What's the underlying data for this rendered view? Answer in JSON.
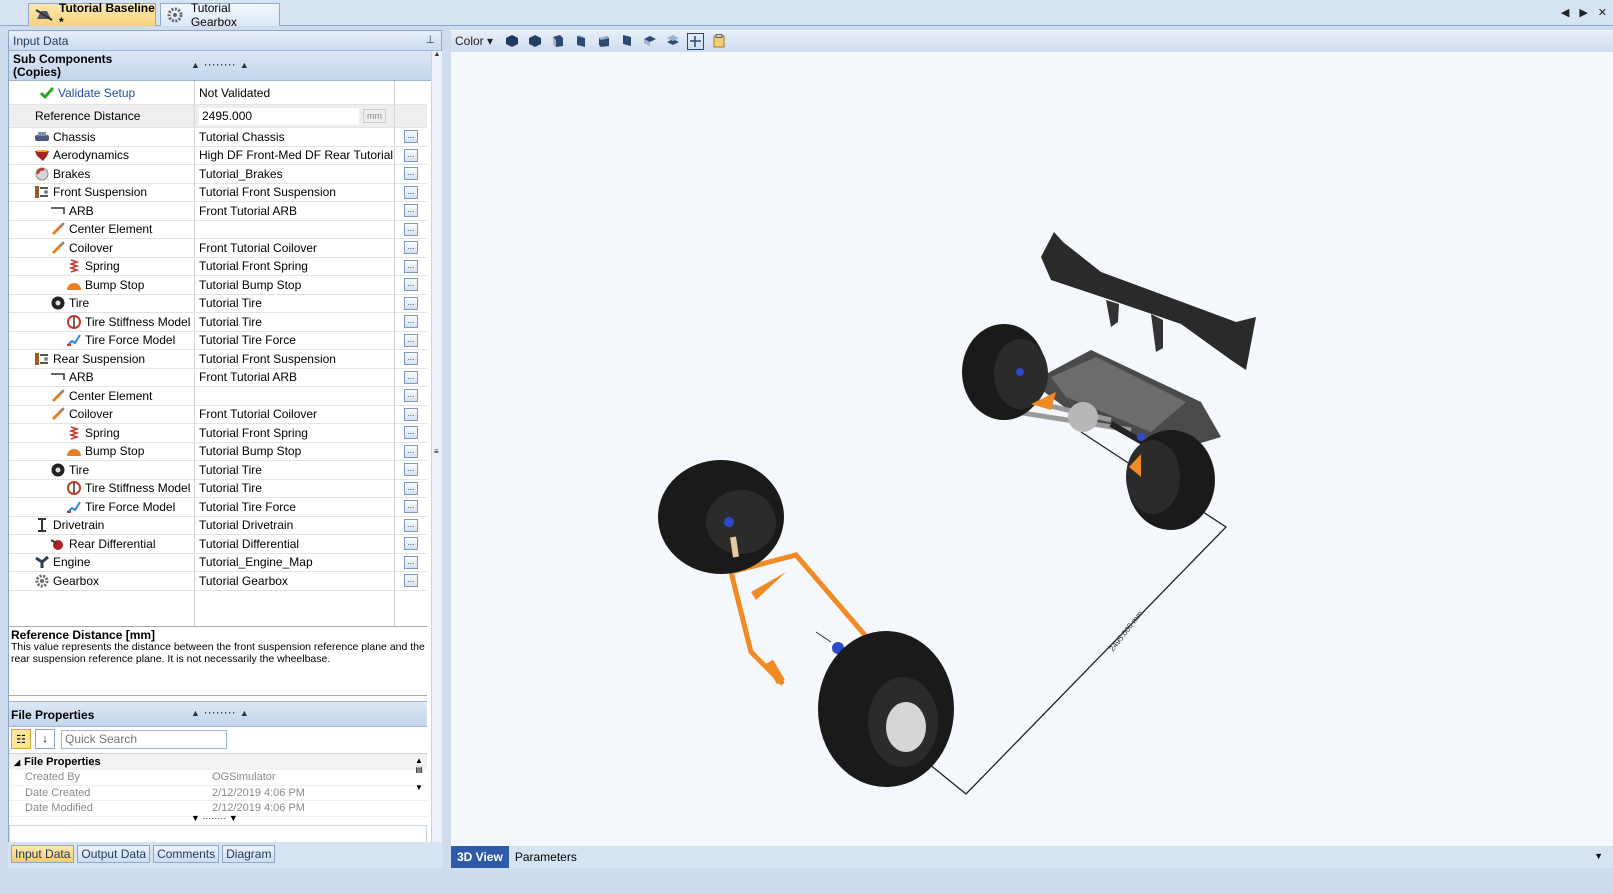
{
  "tabs": [
    {
      "label": "Tutorial Baseline *",
      "icon": "car-icon",
      "active": true
    },
    {
      "label": "Tutorial Gearbox",
      "icon": "gear-icon",
      "active": false
    }
  ],
  "left_panel": {
    "title": "Input Data",
    "subcomponents_header": "Sub Components",
    "subcomponents_subheader": "(Copies)",
    "validate": {
      "label": "Validate Setup",
      "value": "Not Validated"
    },
    "reference_distance": {
      "label": "Reference Distance",
      "value": "2495.000",
      "unit": "mm"
    },
    "rows": [
      {
        "label": "Chassis",
        "value": "Tutorial Chassis",
        "icon": "chassis-icon",
        "level": 0
      },
      {
        "label": "Aerodynamics",
        "value": "High DF Front-Med DF Rear Tutorial",
        "icon": "aerodynamics-icon",
        "level": 0
      },
      {
        "label": "Brakes",
        "value": "Tutorial_Brakes",
        "icon": "brakes-icon",
        "level": 0
      },
      {
        "label": "Front Suspension",
        "value": "Tutorial Front Suspension",
        "icon": "suspension-icon",
        "level": 0
      },
      {
        "label": "ARB",
        "value": "Front Tutorial ARB",
        "icon": "arb-icon",
        "level": 1
      },
      {
        "label": "Center Element",
        "value": "",
        "icon": "damper-icon",
        "level": 1
      },
      {
        "label": "Coilover",
        "value": "Front Tutorial Coilover",
        "icon": "damper-icon",
        "level": 1
      },
      {
        "label": "Spring",
        "value": "Tutorial Front Spring",
        "icon": "spring-icon",
        "level": 2
      },
      {
        "label": "Bump Stop",
        "value": "Tutorial Bump Stop",
        "icon": "bump-stop-icon",
        "level": 2
      },
      {
        "label": "Tire",
        "value": "Tutorial Tire",
        "icon": "tire-icon",
        "level": 1
      },
      {
        "label": "Tire Stiffness Model",
        "value": "Tutorial Tire",
        "icon": "tire-stiffness-icon",
        "level": 2
      },
      {
        "label": "Tire Force Model",
        "value": "Tutorial Tire Force",
        "icon": "tire-force-icon",
        "level": 2
      },
      {
        "label": "Rear Suspension",
        "value": "Tutorial Front Suspension",
        "icon": "suspension-icon",
        "level": 0
      },
      {
        "label": "ARB",
        "value": "Front Tutorial ARB",
        "icon": "arb-icon",
        "level": 1
      },
      {
        "label": "Center Element",
        "value": "",
        "icon": "damper-icon",
        "level": 1
      },
      {
        "label": "Coilover",
        "value": "Front Tutorial Coilover",
        "icon": "damper-icon",
        "level": 1
      },
      {
        "label": "Spring",
        "value": "Tutorial Front Spring",
        "icon": "spring-icon",
        "level": 2
      },
      {
        "label": "Bump Stop",
        "value": "Tutorial Bump Stop",
        "icon": "bump-stop-icon",
        "level": 2
      },
      {
        "label": "Tire",
        "value": "Tutorial Tire",
        "icon": "tire-icon",
        "level": 1
      },
      {
        "label": "Tire Stiffness Model",
        "value": "Tutorial Tire",
        "icon": "tire-stiffness-icon",
        "level": 2
      },
      {
        "label": "Tire Force Model",
        "value": "Tutorial Tire Force",
        "icon": "tire-force-icon",
        "level": 2
      },
      {
        "label": "Drivetrain",
        "value": "Tutorial Drivetrain",
        "icon": "drivetrain-icon",
        "level": 0
      },
      {
        "label": "Rear Differential",
        "value": "Tutorial Differential",
        "icon": "differential-icon",
        "level": 1
      },
      {
        "label": "Engine",
        "value": "Tutorial_Engine_Map",
        "icon": "engine-icon",
        "level": 0
      },
      {
        "label": "Gearbox",
        "value": "Tutorial Gearbox",
        "icon": "gear-icon",
        "level": 0
      }
    ],
    "ellipsis_label": "...",
    "description": {
      "title": "Reference Distance [mm]",
      "text": "This value represents the distance between the front suspension reference plane and the rear suspension reference plane. It is not necessarily the wheelbase."
    },
    "file_properties": {
      "header": "File Properties",
      "search_placeholder": "Quick Search",
      "category": "File Properties",
      "rows": [
        {
          "label": "Created By",
          "value": "OGSimulator"
        },
        {
          "label": "Date Created",
          "value": "2/12/2019 4:06 PM"
        },
        {
          "label": "Date Modified",
          "value": "2/12/2019 4:06 PM"
        }
      ]
    },
    "bottom_tabs": [
      "Input Data",
      "Output Data",
      "Comments",
      "Diagram"
    ]
  },
  "view": {
    "color_label": "Color",
    "dimension_label": "2495.000 mm",
    "bottom_tabs": [
      "3D View",
      "Parameters"
    ],
    "colors": {
      "tire": "#1a1a1a",
      "arm": "#f08a24",
      "wing": "#2a2a2a",
      "accent": "#2f5aa8"
    }
  }
}
